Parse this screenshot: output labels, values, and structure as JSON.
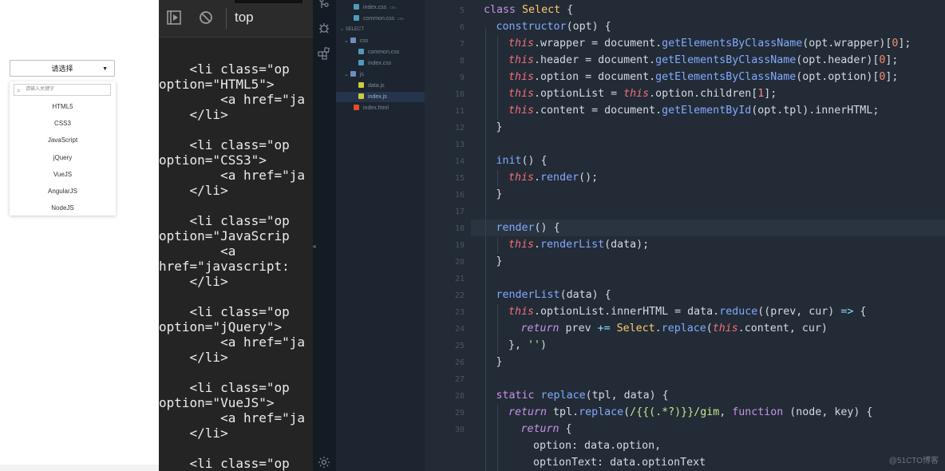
{
  "preview": {
    "select_label": "请选择",
    "search_placeholder": "请输入关键字",
    "options": [
      "HTML5",
      "CSS3",
      "JavaScript",
      "jQuery",
      "VueJS",
      "AngularJS",
      "NodeJS"
    ]
  },
  "devtools": {
    "context": "top",
    "lines": [
      "    <li class=\"op",
      "option=\"HTML5\">",
      "        <a href=\"ja",
      "    </li>",
      "",
      "    <li class=\"op",
      "option=\"CSS3\">",
      "        <a href=\"ja",
      "    </li>",
      "",
      "    <li class=\"op",
      "option=\"JavaScrip",
      "        <a",
      "href=\"javascript:",
      "    </li>",
      "",
      "    <li class=\"op",
      "option=\"jQuery\">",
      "        <a href=\"ja",
      "    </li>",
      "",
      "    <li class=\"op",
      "option=\"VueJS\">",
      "        <a href=\"ja",
      "    </li>",
      "",
      "    <li class=\"op"
    ]
  },
  "explorer": {
    "files": [
      {
        "name": "index.css",
        "hint": "css",
        "color": "#519aba"
      },
      {
        "name": "common.css",
        "hint": "css",
        "color": "#519aba"
      },
      {
        "name": "SELECT",
        "hint": "",
        "color": ""
      },
      {
        "name": "css",
        "hint": "",
        "color": "#6c8ebf"
      },
      {
        "name": "common.css",
        "hint": "",
        "color": "#519aba"
      },
      {
        "name": "index.css",
        "hint": "",
        "color": "#519aba"
      },
      {
        "name": "js",
        "hint": "",
        "color": "#6c8ebf"
      },
      {
        "name": "data.js",
        "hint": "",
        "color": "#cbcb41"
      },
      {
        "name": "index.js",
        "hint": "",
        "color": "#cbcb41"
      },
      {
        "name": "index.html",
        "hint": "",
        "color": "#e44d26"
      }
    ],
    "collapse_marker": "«"
  },
  "editor": {
    "line_numbers": [
      "5",
      "6",
      "7",
      "8",
      "9",
      "10",
      "11",
      "12",
      "13",
      "14",
      "15",
      "16",
      "17",
      "18",
      "19",
      "20",
      "21",
      "22",
      "23",
      "24",
      "25",
      "26",
      "27",
      "28",
      "29",
      "30"
    ],
    "watermark": "@51CTO博客"
  }
}
